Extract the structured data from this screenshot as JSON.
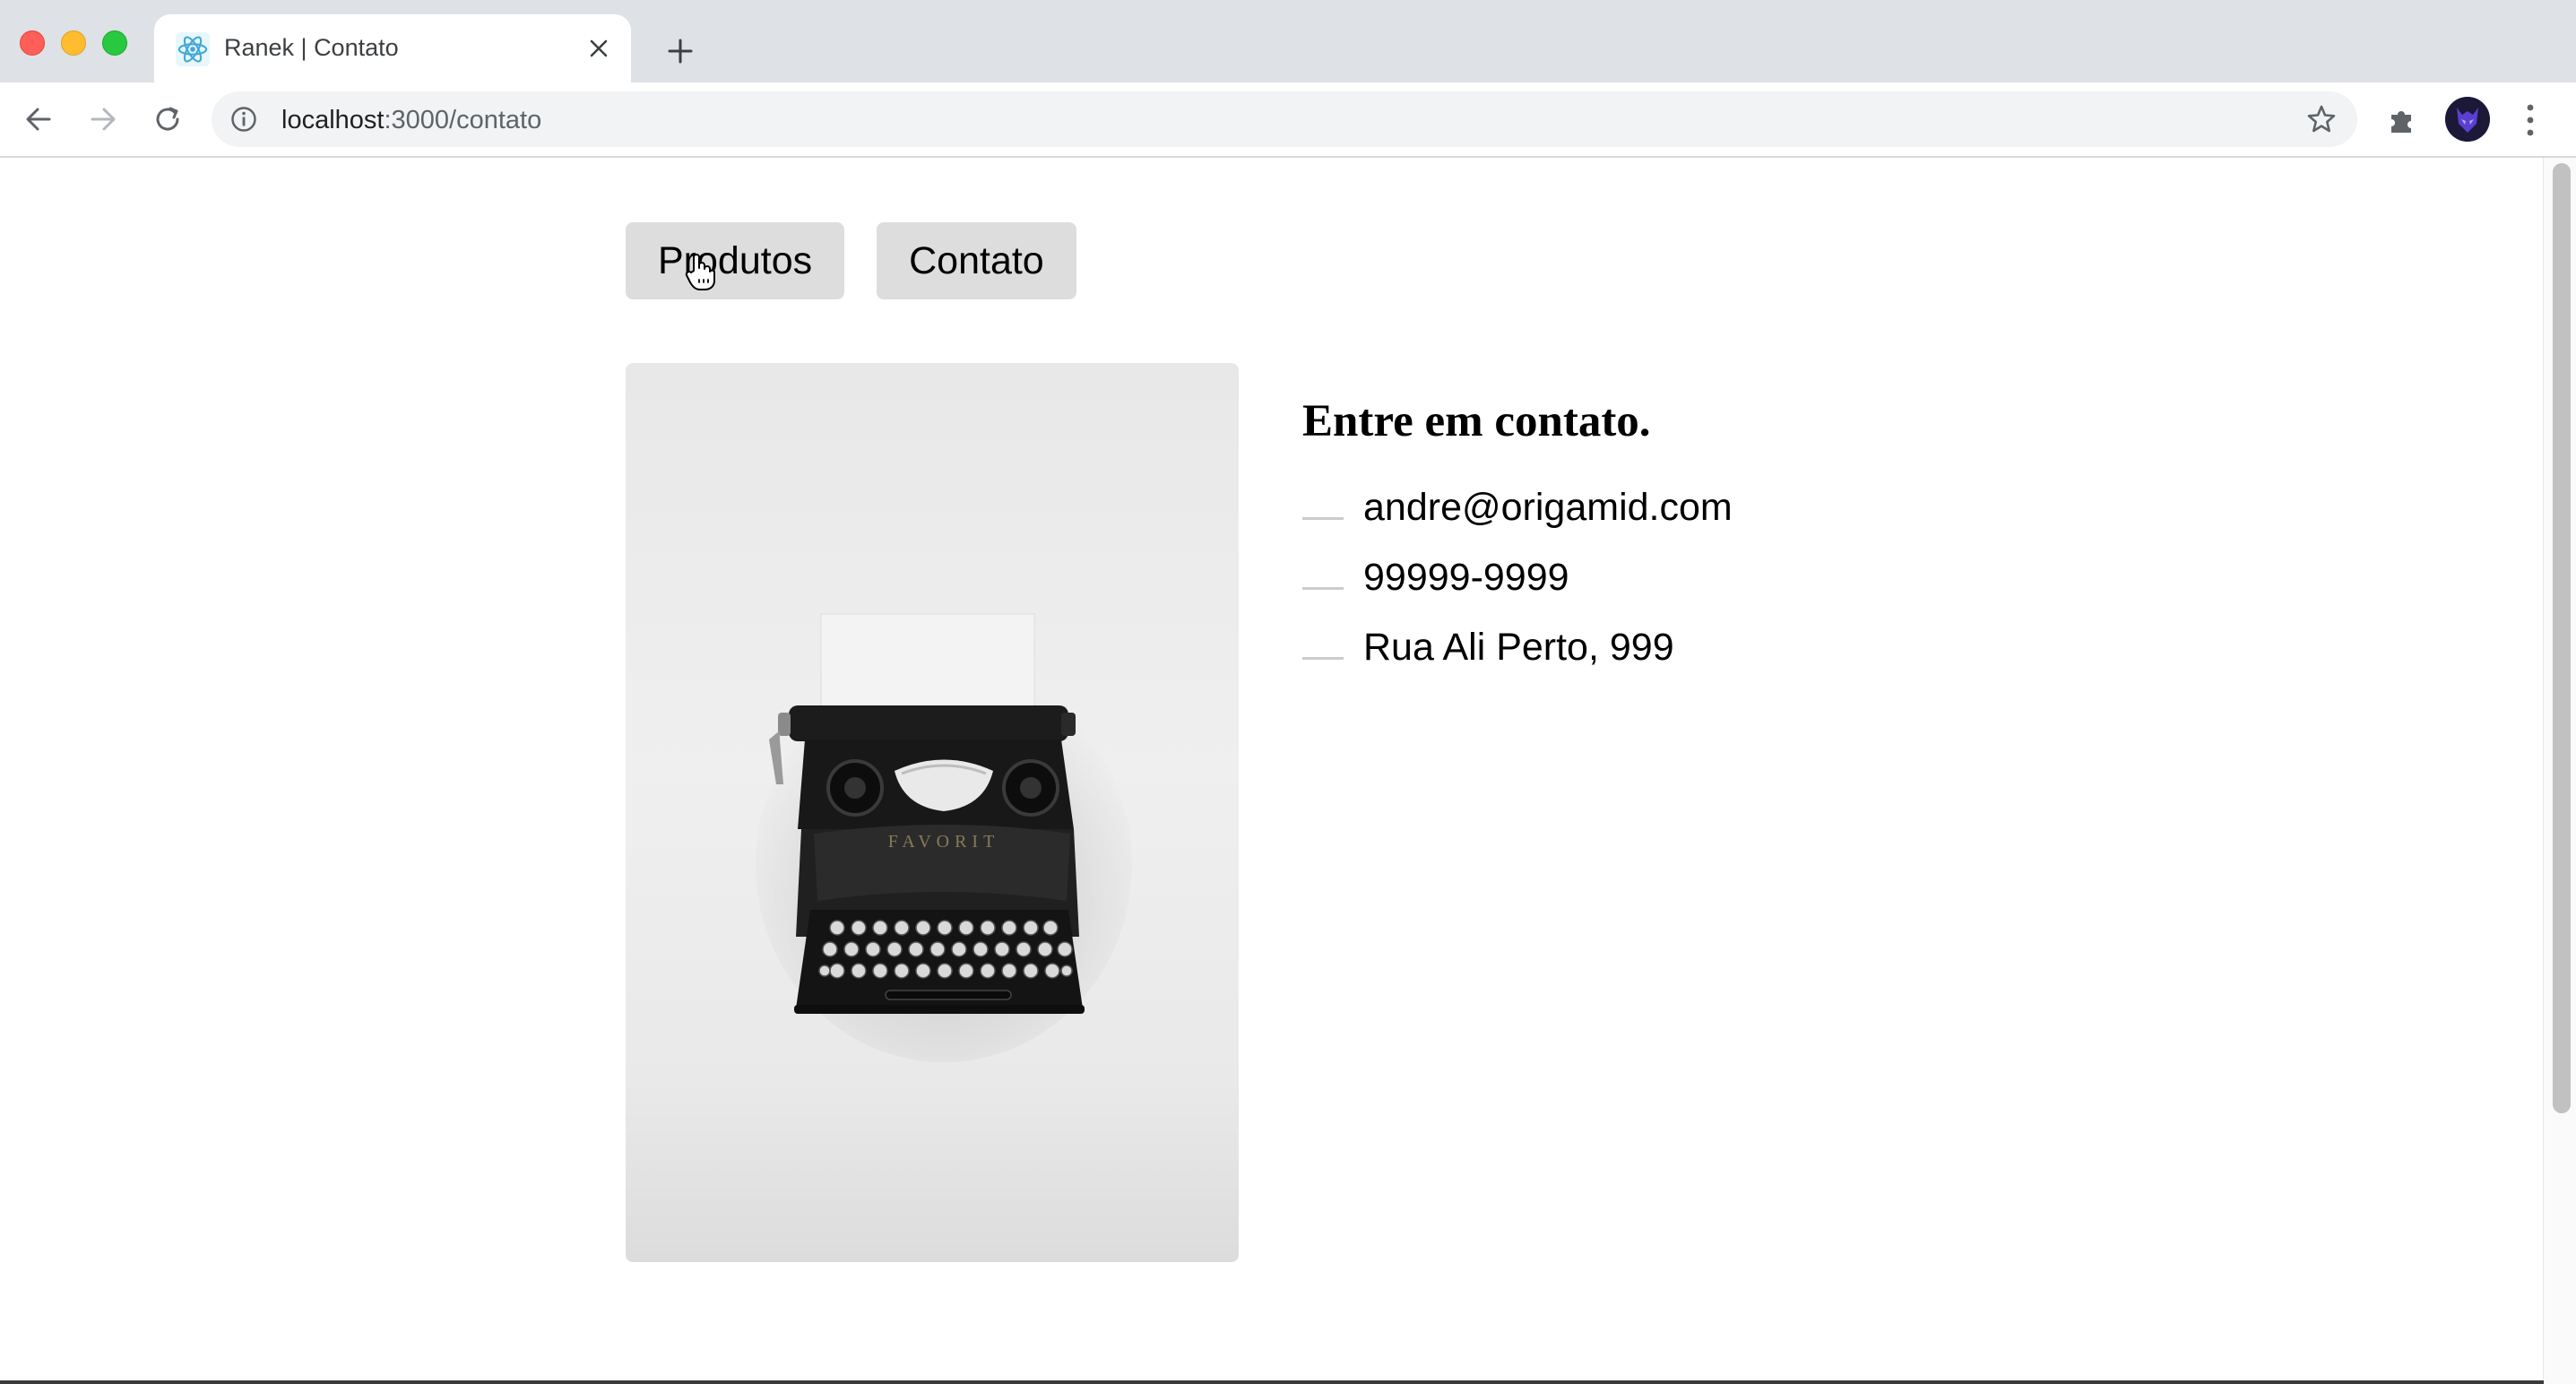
{
  "browser": {
    "tab_title": "Ranek | Contato",
    "url_host": "localhost",
    "url_rest": ":3000/contato"
  },
  "icons": {
    "favicon": "react-logo-icon",
    "close": "close-icon",
    "new_tab": "plus-icon",
    "back": "back-arrow-icon",
    "forward": "forward-arrow-icon",
    "reload": "reload-icon",
    "info": "info-icon",
    "bookmark": "star-icon",
    "extensions": "puzzle-icon",
    "profile": "avatar",
    "menu": "kebab-menu-icon",
    "cursor": "hand-pointer-icon"
  },
  "colors": {
    "nav_button_bg": "#dddddd",
    "list_dash": "#cccccc"
  },
  "nav": {
    "links": [
      {
        "label": "Produtos"
      },
      {
        "label": "Contato"
      }
    ]
  },
  "contact": {
    "image": "typewriter-photo",
    "title": "Entre em contato.",
    "items": [
      {
        "text": "andre@origamid.com"
      },
      {
        "text": "99999-9999"
      },
      {
        "text": "Rua Ali Perto, 999"
      }
    ]
  }
}
